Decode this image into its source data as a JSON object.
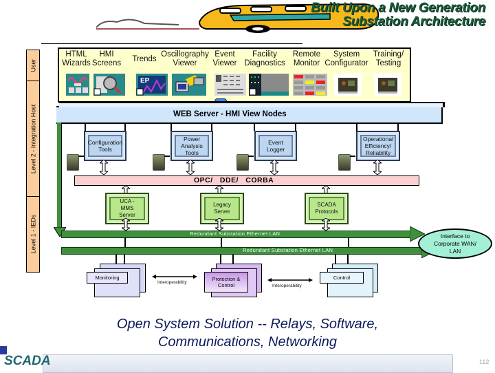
{
  "header": {
    "title_line1": "Built Upon a New Generation",
    "title_line2": "Substation Architecture"
  },
  "levels": [
    {
      "label": "User"
    },
    {
      "label": "Level 2 - Integration Host"
    },
    {
      "label": "Level 1 - IEDs"
    }
  ],
  "apps": [
    {
      "label_line1": "HTML",
      "label_line2": "Wizards",
      "icon": "html-wizard-icon"
    },
    {
      "label_line1": "HMI",
      "label_line2": "Screens",
      "icon": "hmi-screens-icon"
    },
    {
      "label_line1": "",
      "label_line2": "Trends",
      "icon": "trends-icon"
    },
    {
      "label_line1": "Oscillography",
      "label_line2": "Viewer",
      "icon": "oscillography-viewer-icon"
    },
    {
      "label_line1": "Event",
      "label_line2": "Viewer",
      "icon": "event-viewer-icon"
    },
    {
      "label_line1": "Facility",
      "label_line2": "Diagnostics",
      "icon": "facility-diagnostics-icon"
    },
    {
      "label_line1": "Remote",
      "label_line2": "Monitor",
      "icon": "remote-monitor-icon"
    },
    {
      "label_line1": "System",
      "label_line2": "Configurator",
      "icon": "system-configurator-icon"
    },
    {
      "label_line1": "Training/",
      "label_line2": "Testing",
      "icon": "training-testing-icon"
    }
  ],
  "web_server": {
    "label": "WEB Server  -  HMI  View Nodes"
  },
  "tools": [
    {
      "label": "Configuration Tools"
    },
    {
      "label": "Power Analysis Tools"
    },
    {
      "label": "Event Logger"
    },
    {
      "label": "Operational Efficiency/ Reliability"
    }
  ],
  "middleware": {
    "label": "OPC/   DDE/   CORBA"
  },
  "servers": [
    {
      "label": "UCA - MMS Server"
    },
    {
      "label": "Legacy Server"
    },
    {
      "label": "SCADA Protocols"
    }
  ],
  "lans": [
    {
      "label": "Redundant Substation Ethernet LAN"
    },
    {
      "label": "Redundant Substation Ethernet LAN"
    }
  ],
  "interface": {
    "label": "Interface to Corporate WAN/  LAN"
  },
  "ied_groups": [
    {
      "label": "Monitoring"
    },
    {
      "label": "Protection & Control"
    },
    {
      "label": "Control"
    }
  ],
  "interop_labels": [
    "Interoperability",
    "Interoperability"
  ],
  "slogan": {
    "line1": "Open System Solution -- Relays, Software,",
    "line2": "Communications, Networking"
  },
  "footer": {
    "brand": "SCADA",
    "page_number": "112"
  },
  "colors": {
    "title_green": "#1a5a3a",
    "lan_green": "#3f8f3f",
    "web_blue": "#cfe6fb",
    "middleware_pink": "#fbd0d0",
    "level_orange": "#fbcd9b",
    "slogan_navy": "#0c1a5a"
  }
}
